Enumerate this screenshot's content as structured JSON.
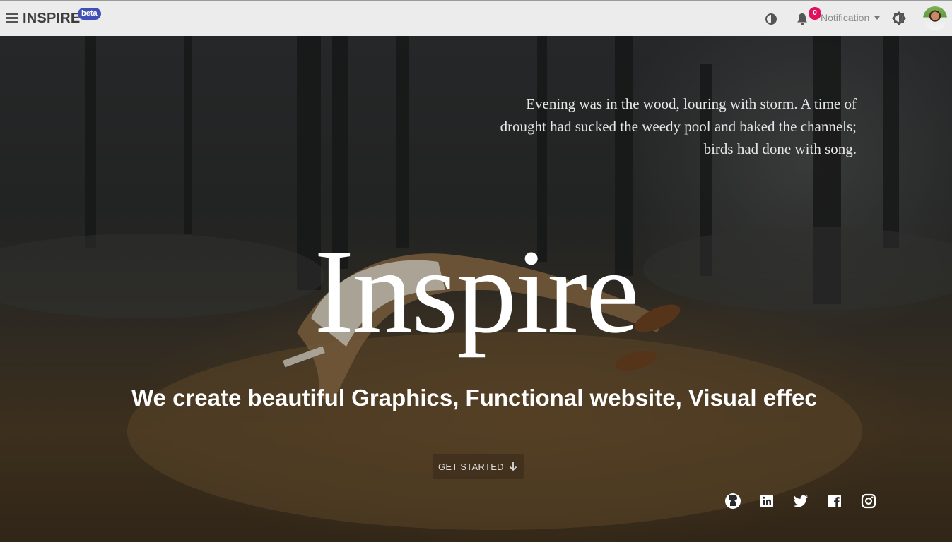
{
  "header": {
    "brand": "INSPIRE",
    "badge": "beta",
    "notification_count": "0",
    "notification_label": "Notification"
  },
  "icons": {
    "menu": "menu-icon",
    "contrast": "contrast-icon",
    "bell": "bell-icon",
    "theme": "brightness-icon",
    "avatar": "user-avatar",
    "arrow": "arrow-down-icon",
    "social": [
      "github-icon",
      "linkedin-icon",
      "twitter-icon",
      "facebook-icon",
      "instagram-icon"
    ]
  },
  "hero": {
    "quote": "Evening was in the wood, louring with storm. A time of drought had sucked the weedy pool and baked the channels; birds had done with song.",
    "title": "Inspire",
    "tagline": "We create beautiful Graphics, Functional website, Visual effects",
    "cta_label": "GET STARTED"
  },
  "colors": {
    "topbar": "#ececec",
    "badge": "#3f51b5",
    "notification_badge": "#e0115f"
  }
}
